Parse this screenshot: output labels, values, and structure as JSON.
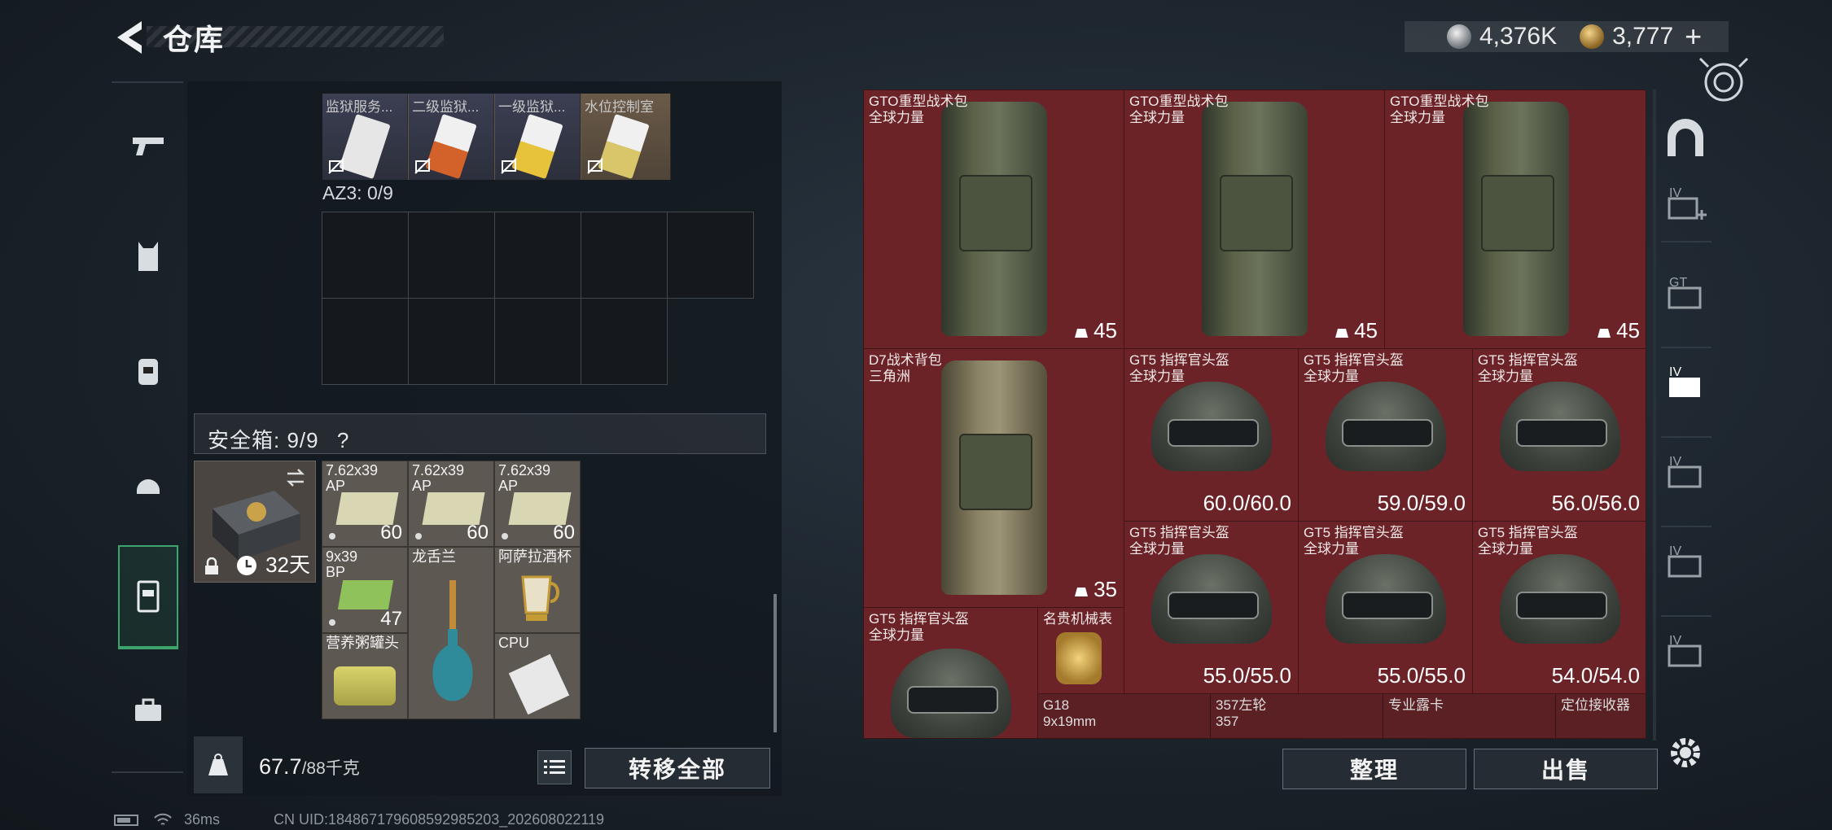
{
  "header": {
    "title": "仓库",
    "currency_silver": "4,376K",
    "currency_gold": "3,777",
    "plus": "+"
  },
  "left_nav": [
    "weapons-tab",
    "armor-tab",
    "backpack-tab",
    "helmet-tab",
    "container-tab",
    "case-tab"
  ],
  "container": {
    "top_items": [
      "监狱服务...",
      "二级监狱...",
      "一级监狱...",
      "水位控制室"
    ],
    "az3_label": "AZ3: 0/9",
    "safe_box_label": "安全箱: 9/9",
    "safe_help": "?",
    "safe_days": "32天",
    "items": [
      {
        "name": "7.62x39\nAP",
        "qty": "60"
      },
      {
        "name": "7.62x39\nAP",
        "qty": "60"
      },
      {
        "name": "7.62x39\nAP",
        "qty": "60"
      },
      {
        "name": "9x39\nBP",
        "qty": "47"
      },
      {
        "name": "龙舌兰",
        "qty": ""
      },
      {
        "name": "阿萨拉酒杯",
        "qty": ""
      },
      {
        "name": "营养粥罐头",
        "qty": ""
      },
      {
        "name": "",
        "qty": ""
      },
      {
        "name": "CPU",
        "qty": ""
      }
    ],
    "weight_value": "67.7",
    "weight_total": "/88千克",
    "transfer_all": "转移全部"
  },
  "stash": {
    "items": [
      {
        "name": "GTO重型战术包\n全球力量",
        "weight": "45"
      },
      {
        "name": "GTO重型战术包\n全球力量",
        "weight": "45"
      },
      {
        "name": "GTO重型战术包\n全球力量",
        "weight": "45"
      },
      {
        "name": "D7战术背包\n三角洲",
        "weight": "35"
      },
      {
        "name": "GT5 指挥官头盔\n全球力量",
        "dura": "60.0/60.0"
      },
      {
        "name": "GT5 指挥官头盔\n全球力量",
        "dura": "59.0/59.0"
      },
      {
        "name": "GT5 指挥官头盔\n全球力量",
        "dura": "56.0/56.0"
      },
      {
        "name": "GT5 指挥官头盔\n全球力量",
        "dura": "55.0/55.0"
      },
      {
        "name": "GT5 指挥官头盔\n全球力量",
        "dura": "55.0/55.0"
      },
      {
        "name": "GT5 指挥官头盔\n全球力量",
        "dura": "54.0/54.0"
      },
      {
        "name": "GT5 指挥官头盔\n全球力量",
        "dura": ""
      },
      {
        "name": "名贵机械表",
        "dura": ""
      },
      {
        "name": "G18\n9x19mm",
        "dura": ""
      },
      {
        "name": "357左轮\n357",
        "dura": ""
      },
      {
        "name": "专业露卡",
        "dura": ""
      },
      {
        "name": "定位接收器",
        "dura": ""
      }
    ],
    "organize": "整理",
    "sell": "出售"
  },
  "status": {
    "ping": "36ms",
    "uid": "CN UID:184867179608592985203_202608022119"
  },
  "colors": {
    "stash_bg": "#581b1e",
    "accent_green": "#3da56c"
  }
}
